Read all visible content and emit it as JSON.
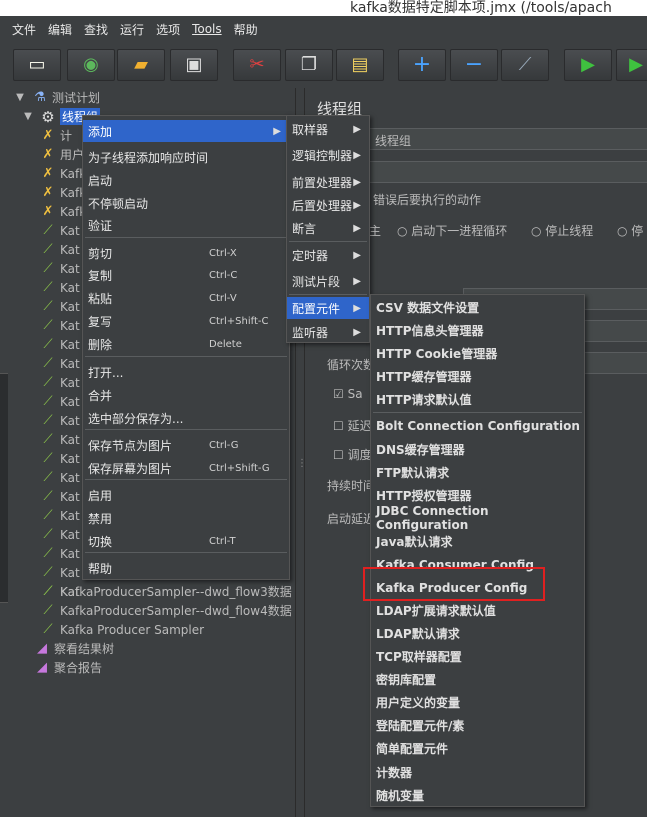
{
  "top_strip": {
    "text": "kafka数据特定脚本项.jmx (/tools/apach"
  },
  "menubar": [
    "文件",
    "编辑",
    "查找",
    "运行",
    "选项",
    "Tools",
    "帮助"
  ],
  "toolbar": {
    "buttons": [
      "new-icon",
      "templates-icon",
      "open-icon",
      "save-icon",
      "cut-icon",
      "copy-icon",
      "paste-icon",
      "expand-icon",
      "collapse-icon",
      "toggle-icon",
      "start-icon",
      "start-no-pause-icon"
    ]
  },
  "tree": {
    "test_plan": "测试计划",
    "thread_group": "线程组",
    "child_labels": [
      "计",
      "用户",
      "Kafk",
      "Kafk",
      "Kafk",
      "Kat",
      "Kat",
      "Kat",
      "Kat",
      "Kat",
      "Kat",
      "Kat",
      "Kat",
      "Kat",
      "Kat",
      "Kat",
      "Kat",
      "Kat",
      "Kat",
      "Kat",
      "Kat",
      "Kat",
      "Kat",
      "Kat",
      "Kat"
    ],
    "bottom_items": [
      "KafkaProducerSampler--dwd_flow3数据",
      "KafkaProducerSampler--dwd_flow4数据",
      "Kafka Producer Sampler"
    ],
    "listeners": [
      "察看结果树",
      "聚合报告"
    ]
  },
  "right_panel": {
    "title": "线程组",
    "name_value": "线程组",
    "error_action_label": "错误后要执行的动作",
    "options": [
      "启动下一进程循环",
      "停止线程",
      "停"
    ],
    "loop_label": "循环次数",
    "same_user": "Sa",
    "delay": "延迟",
    "scheduler": "调度",
    "duration": "持续时间",
    "startup_delay": "启动延迟"
  },
  "context_menu": {
    "items": [
      {
        "label": "添加",
        "shortcut": "",
        "has_sub": true,
        "highlight": true
      },
      {
        "label": "为子线程添加响应时间",
        "shortcut": "",
        "has_sub": false
      },
      {
        "label": "启动",
        "shortcut": "",
        "has_sub": false
      },
      {
        "label": "不停顿启动",
        "shortcut": "",
        "has_sub": false
      },
      {
        "label": "验证",
        "shortcut": "",
        "has_sub": false
      },
      {
        "label": "剪切",
        "shortcut": "Ctrl-X",
        "has_sub": false
      },
      {
        "label": "复制",
        "shortcut": "Ctrl-C",
        "has_sub": false
      },
      {
        "label": "粘贴",
        "shortcut": "Ctrl-V",
        "has_sub": false
      },
      {
        "label": "复写",
        "shortcut": "Ctrl+Shift-C",
        "has_sub": false
      },
      {
        "label": "删除",
        "shortcut": "Delete",
        "has_sub": false
      },
      {
        "label": "打开...",
        "shortcut": "",
        "has_sub": false
      },
      {
        "label": "合并",
        "shortcut": "",
        "has_sub": false
      },
      {
        "label": "选中部分保存为...",
        "shortcut": "",
        "has_sub": false
      },
      {
        "label": "保存节点为图片",
        "shortcut": "Ctrl-G",
        "has_sub": false
      },
      {
        "label": "保存屏幕为图片",
        "shortcut": "Ctrl+Shift-G",
        "has_sub": false
      },
      {
        "label": "启用",
        "shortcut": "",
        "has_sub": false
      },
      {
        "label": "禁用",
        "shortcut": "",
        "has_sub": false
      },
      {
        "label": "切换",
        "shortcut": "Ctrl-T",
        "has_sub": false
      },
      {
        "label": "帮助",
        "shortcut": "",
        "has_sub": false
      }
    ]
  },
  "add_submenu": {
    "items": [
      "取样器",
      "逻辑控制器",
      "前置处理器",
      "后置处理器",
      "断言",
      "定时器",
      "测试片段",
      "配置元件",
      "监听器"
    ],
    "highlight_index": 7
  },
  "config_submenu": {
    "items": [
      "CSV 数据文件设置",
      "HTTP信息头管理器",
      "HTTP Cookie管理器",
      "HTTP缓存管理器",
      "HTTP请求默认值",
      "Bolt Connection Configuration",
      "DNS缓存管理器",
      "FTP默认请求",
      "HTTP授权管理器",
      "JDBC Connection Configuration",
      "Java默认请求",
      "Kafka Consumer Config",
      "Kafka Producer Config",
      "LDAP扩展请求默认值",
      "LDAP默认请求",
      "TCP取样器配置",
      "密钥库配置",
      "用户定义的变量",
      "登陆配置元件/素",
      "简单配置元件",
      "计数器",
      "随机变量"
    ],
    "marked": "Kafka Producer Config"
  },
  "colors": {
    "highlight": "#2f65ca",
    "marker": "#e02020",
    "background": "#3c3f41"
  }
}
